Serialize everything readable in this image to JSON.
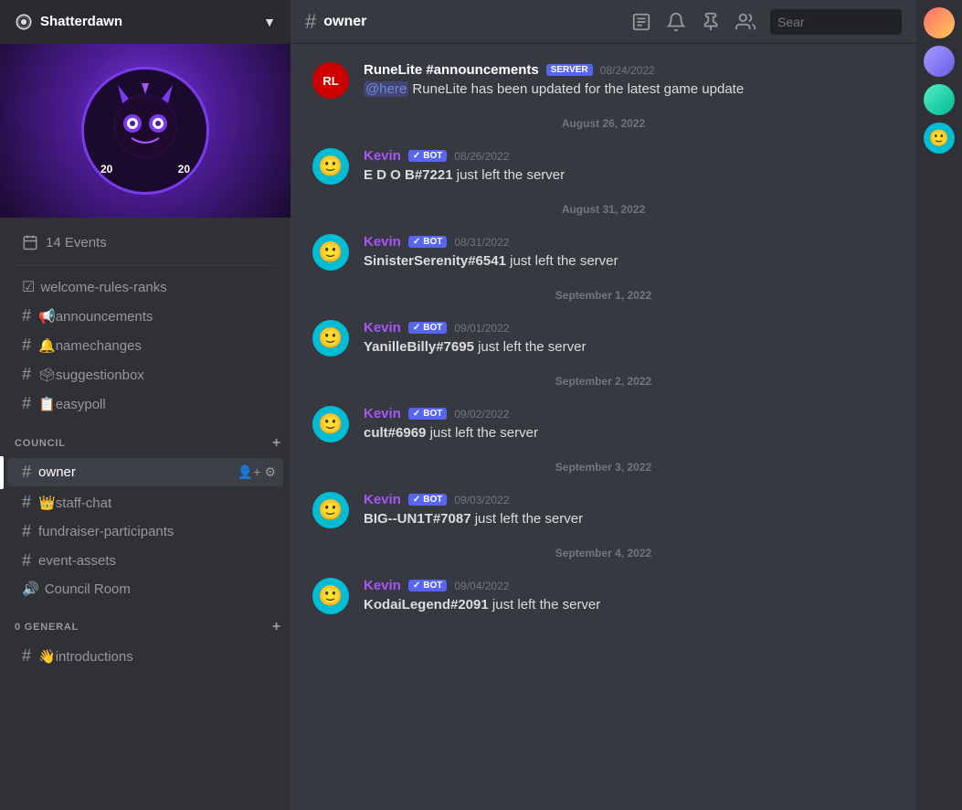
{
  "server": {
    "name": "Shatterdawn",
    "banner_year_left": "20",
    "banner_year_right": "20"
  },
  "sidebar": {
    "events_label": "14 Events",
    "channels_general": [
      {
        "type": "rules",
        "prefix": "☑",
        "name": "welcome-rules-ranks"
      },
      {
        "type": "hash",
        "prefix": "#",
        "name": "announcements",
        "emoji": "📢"
      },
      {
        "type": "hash",
        "prefix": "#",
        "name": "namechanges",
        "emoji": "🔔"
      },
      {
        "type": "hash",
        "prefix": "#",
        "name": "suggestionbox",
        "emoji": "🗳"
      },
      {
        "type": "hash",
        "prefix": "#",
        "name": "easypoll",
        "emoji": "📋"
      }
    ],
    "category_council": "COUNCIL",
    "channels_council": [
      {
        "name": "owner",
        "active": true
      },
      {
        "name": "staff-chat",
        "emoji": "👑"
      },
      {
        "name": "fundraiser-participants"
      },
      {
        "name": "event-assets"
      },
      {
        "type": "voice",
        "name": "Council Room"
      }
    ],
    "category_general": "0 GENERAL",
    "channels_bottom": [
      {
        "name": "introductions",
        "emoji": "👋"
      }
    ]
  },
  "channel": {
    "name": "owner"
  },
  "header": {
    "search_placeholder": "Sear"
  },
  "messages": [
    {
      "id": "msg1",
      "avatar_type": "rl",
      "avatar_text": "RL",
      "author": "RuneLite #announcements",
      "author_class": "runelite",
      "badge": "SERVER",
      "timestamp": "08/24/2022",
      "text_parts": [
        {
          "type": "mention",
          "text": "@here"
        },
        {
          "type": "normal",
          "text": " RuneLite has been updated for the latest game update"
        }
      ]
    },
    {
      "id": "divider1",
      "type": "divider",
      "text": "August 26, 2022"
    },
    {
      "id": "msg2",
      "avatar_type": "kevin",
      "author": "Kevin",
      "author_class": "kevin",
      "badge": "BOT",
      "timestamp": "08/26/2022",
      "text_parts": [
        {
          "type": "bold",
          "text": "E D O B#7221"
        },
        {
          "type": "normal",
          "text": " just left the server"
        }
      ]
    },
    {
      "id": "divider2",
      "type": "divider",
      "text": "August 31, 2022"
    },
    {
      "id": "msg3",
      "avatar_type": "kevin",
      "author": "Kevin",
      "author_class": "kevin",
      "badge": "BOT",
      "timestamp": "08/31/2022",
      "text_parts": [
        {
          "type": "bold",
          "text": "SinisterSerenity#6541"
        },
        {
          "type": "normal",
          "text": " just left the server"
        }
      ]
    },
    {
      "id": "divider3",
      "type": "divider",
      "text": "September 1, 2022"
    },
    {
      "id": "msg4",
      "avatar_type": "kevin",
      "author": "Kevin",
      "author_class": "kevin",
      "badge": "BOT",
      "timestamp": "09/01/2022",
      "text_parts": [
        {
          "type": "bold",
          "text": "YanilleBilly#7695"
        },
        {
          "type": "normal",
          "text": " just left the server"
        }
      ]
    },
    {
      "id": "divider4",
      "type": "divider",
      "text": "September 2, 2022"
    },
    {
      "id": "msg5",
      "avatar_type": "kevin",
      "author": "Kevin",
      "author_class": "kevin",
      "badge": "BOT",
      "timestamp": "09/02/2022",
      "text_parts": [
        {
          "type": "bold",
          "text": "cult#6969"
        },
        {
          "type": "normal",
          "text": " just left the server"
        }
      ]
    },
    {
      "id": "divider5",
      "type": "divider",
      "text": "September 3, 2022"
    },
    {
      "id": "msg6",
      "avatar_type": "kevin",
      "author": "Kevin",
      "author_class": "kevin",
      "badge": "BOT",
      "timestamp": "09/03/2022",
      "text_parts": [
        {
          "type": "bold",
          "text": "BIG--UN1T#7087"
        },
        {
          "type": "normal",
          "text": " just left the server"
        }
      ]
    },
    {
      "id": "divider6",
      "type": "divider",
      "text": "September 4, 2022"
    },
    {
      "id": "msg7",
      "avatar_type": "kevin",
      "author": "Kevin",
      "author_class": "kevin",
      "badge": "BOT",
      "timestamp": "09/04/2022",
      "text_parts": [
        {
          "type": "bold",
          "text": "KodaiLegend#2091"
        },
        {
          "type": "normal",
          "text": " just left the server"
        }
      ]
    }
  ]
}
